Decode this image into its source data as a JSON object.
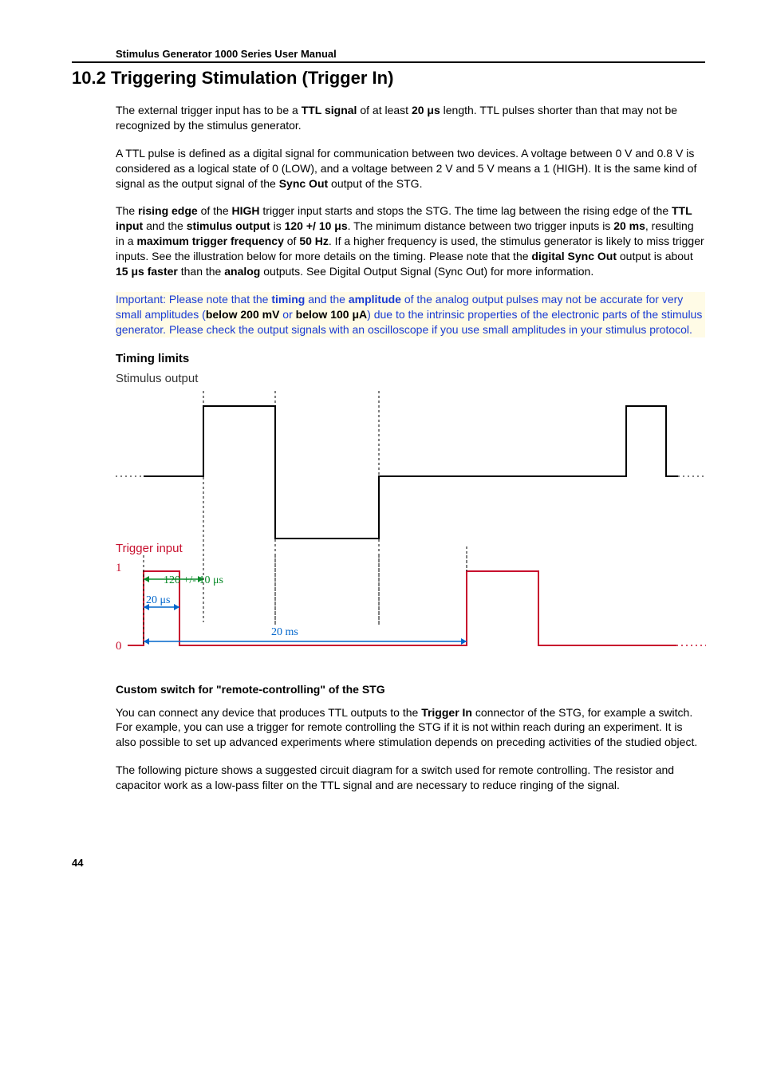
{
  "header": "Stimulus Generator 1000 Series User Manual",
  "section_num": "10.2",
  "section_title": "Triggering Stimulation (Trigger In)",
  "para1": {
    "t1": "The external trigger input has to be a ",
    "b1": "TTL signal",
    "t2": " of at least ",
    "b2": "20 μs",
    "t3": " length. TTL pulses shorter than that may not be recognized by the stimulus generator."
  },
  "para2": {
    "t1": "A TTL pulse is defined as a digital signal for communication between two devices. A voltage between 0 V and 0.8 V is considered as a logical state of 0 (LOW), and a voltage between 2 V and 5 V means a 1 (HIGH). It is the same kind of signal as the output signal of the ",
    "b1": "Sync Out",
    "t2": " output of the STG."
  },
  "para3": {
    "t1": "The ",
    "b1": "rising edge",
    "t2": " of the ",
    "b2": "HIGH",
    "t3": " trigger input starts and stops the STG. The time lag between the rising edge of the ",
    "b3": "TTL input",
    "t4": " and the ",
    "b4": "stimulus output",
    "t5": " is ",
    "b5": "120 +/ 10 μs",
    "t6": ". The minimum distance between two trigger inputs is ",
    "b6": "20 ms",
    "t7": ", resulting in a ",
    "b7": "maximum trigger frequency",
    "t8": " of ",
    "b8": "50 Hz",
    "t9": ". If a higher frequency is used, the stimulus generator is likely to miss trigger inputs. See the illustration below for more details on the timing. Please note that the ",
    "b9": "digital Sync Out",
    "t10": " output is about ",
    "b10": "15 μs faster",
    "t11": " than the ",
    "b11": "analog",
    "t12": " outputs. See Digital Output Signal (Sync Out) for more information."
  },
  "highlight": {
    "t1": "Important: Please note that the ",
    "b1": "timing",
    "t2": " and the ",
    "b2": "amplitude",
    "t3": " of the analog output pulses may not be accurate for very small amplitudes (",
    "b3": "below 200 mV",
    "t4": " or ",
    "b4": "below 100 μA",
    "t5": ") due to the intrinsic properties of the electronic parts of the stimulus generator. Please check the output signals with an oscilloscope if you use small amplitudes in your stimulus protocol."
  },
  "timing_limits": "Timing limits",
  "diagram": {
    "stim_label": "Stimulus output",
    "trig_label": "Trigger input",
    "y1": "1",
    "y0": "0",
    "delay": "120 +/- 10 μs",
    "pulse_width": "20 μs",
    "min_gap": "20 ms"
  },
  "custom_switch_head": "Custom switch for \"remote-controlling\" of the STG",
  "para4": {
    "t1": "You can connect any device that produces TTL outputs to the ",
    "b1": "Trigger In",
    "t2": " connector of the STG, for example a switch. For example, you can use a trigger for remote controlling the STG if it is not within reach during an experiment. It is also possible to set up advanced experiments where stimulation depends on preceding activities of the studied object."
  },
  "para5": "The following picture shows a suggested circuit diagram for a switch used for remote controlling. The resistor and capacitor work as a low-pass filter on the TTL signal and are necessary to reduce ringing of the signal.",
  "page_number": "44"
}
